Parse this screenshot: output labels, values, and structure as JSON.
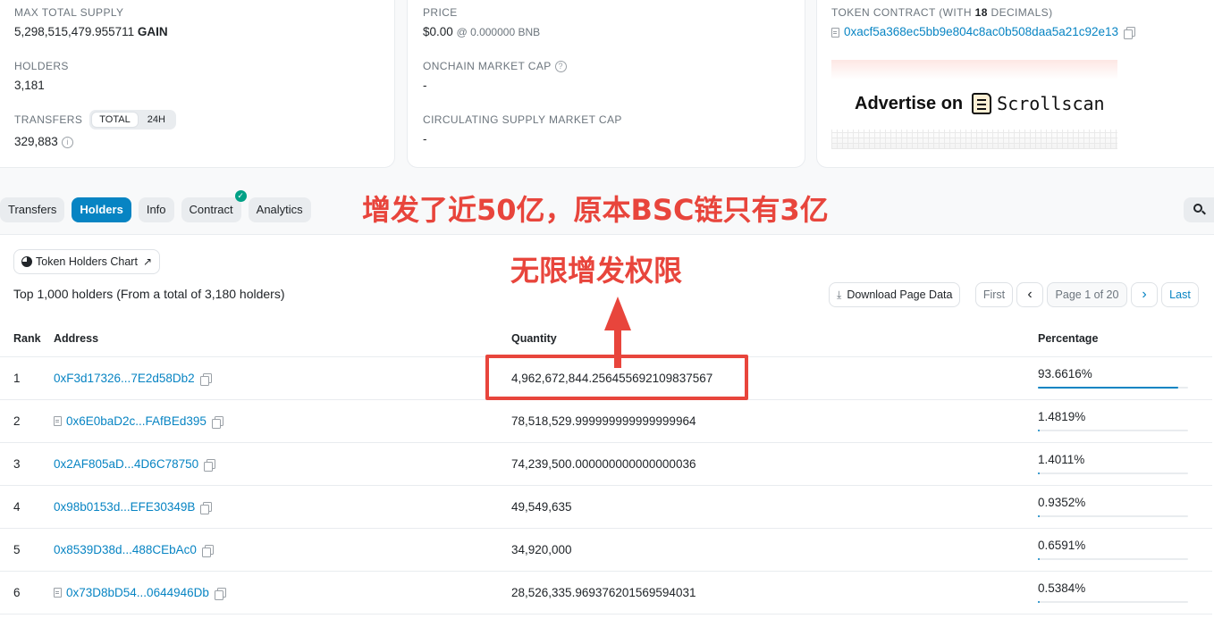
{
  "overview": {
    "max_total_supply_label": "MAX TOTAL SUPPLY",
    "max_total_supply_value": "5,298,515,479.955711",
    "token_symbol": "GAIN",
    "holders_label": "HOLDERS",
    "holders_value": "3,181",
    "transfers_label": "TRANSFERS",
    "transfers_toggle_total": "TOTAL",
    "transfers_toggle_24h": "24H",
    "transfers_value": "329,883"
  },
  "market": {
    "price_label": "PRICE",
    "price_value": "$0.00",
    "price_bnb": "@ 0.000000 BNB",
    "onchain_cap_label": "ONCHAIN MARKET CAP",
    "onchain_cap_value": "-",
    "circ_cap_label": "CIRCULATING SUPPLY MARKET CAP",
    "circ_cap_value": "-"
  },
  "contract": {
    "label_prefix": "TOKEN CONTRACT (WITH",
    "decimals": "18",
    "label_suffix": "DECIMALS)",
    "address": "0xacf5a368ec5bb9e804c8ac0b508daa5a21c92e13",
    "ad_text": "Advertise on",
    "ad_brand": "Scrollscan"
  },
  "tabs": [
    {
      "label": "Transfers"
    },
    {
      "label": "Holders"
    },
    {
      "label": "Info"
    },
    {
      "label": "Contract"
    },
    {
      "label": "Analytics"
    }
  ],
  "holders_section": {
    "chart_button": "Token Holders Chart",
    "summary": "Top 1,000 holders (From a total of 3,180 holders)",
    "download_button": "Download Page Data",
    "pagination": {
      "first": "First",
      "prev": "‹",
      "page": "Page 1 of 20",
      "next": "›",
      "last": "Last"
    },
    "columns": {
      "rank": "Rank",
      "address": "Address",
      "quantity": "Quantity",
      "percentage": "Percentage"
    },
    "rows": [
      {
        "rank": "1",
        "address": "0xF3d17326...7E2d58Db2",
        "contract": false,
        "quantity": "4,962,672,844.256455692109837567",
        "percentage": "93.6616%",
        "pct": 93.6616
      },
      {
        "rank": "2",
        "address": "0x6E0baD2c...FAfBEd395",
        "contract": true,
        "quantity": "78,518,529.999999999999999964",
        "percentage": "1.4819%",
        "pct": 1.4819
      },
      {
        "rank": "3",
        "address": "0x2AF805aD...4D6C78750",
        "contract": false,
        "quantity": "74,239,500.000000000000000036",
        "percentage": "1.4011%",
        "pct": 1.4011
      },
      {
        "rank": "4",
        "address": "0x98b0153d...EFE30349B",
        "contract": false,
        "quantity": "49,549,635",
        "percentage": "0.9352%",
        "pct": 0.9352
      },
      {
        "rank": "5",
        "address": "0x8539D38d...488CEbAc0",
        "contract": false,
        "quantity": "34,920,000",
        "percentage": "0.6591%",
        "pct": 0.6591
      },
      {
        "rank": "6",
        "address": "0x73D8bD54...0644946Db",
        "contract": true,
        "quantity": "28,526,335.969376201569594031",
        "percentage": "0.5384%",
        "pct": 0.5384
      }
    ]
  },
  "annotations": {
    "line1": "增发了近50亿，原本BSC链只有3亿",
    "line2": "无限增发权限",
    "color": "#e8453c"
  },
  "colors": {
    "link": "#0784c3",
    "accent": "#0784c3",
    "annotation": "#e8453c"
  }
}
